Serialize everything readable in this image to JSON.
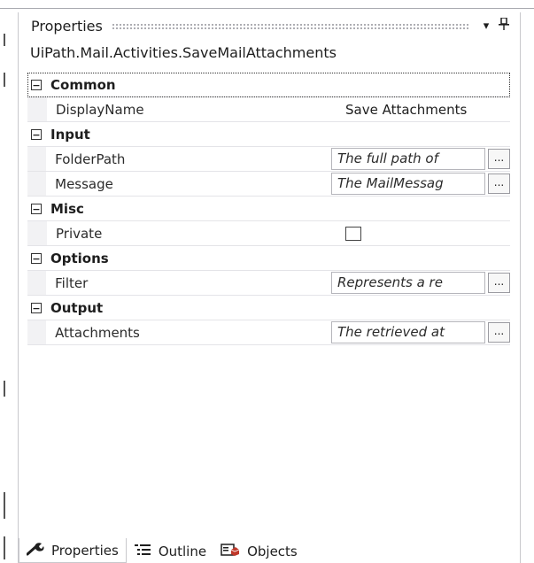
{
  "panel": {
    "title": "Properties",
    "dropdown_glyph": "▾",
    "pin_glyph": "⊥",
    "type_name": "UiPath.Mail.Activities.SaveMailAttachments"
  },
  "categories": [
    {
      "toggle": "−",
      "label": "Common",
      "props": [
        {
          "name": "DisplayName",
          "kind": "plain",
          "value": "Save Attachments"
        }
      ]
    },
    {
      "toggle": "−",
      "label": "Input",
      "props": [
        {
          "name": "FolderPath",
          "kind": "field",
          "value": "The full path of",
          "button": "..."
        },
        {
          "name": "Message",
          "kind": "field",
          "value": "The MailMessag",
          "button": "..."
        }
      ]
    },
    {
      "toggle": "−",
      "label": "Misc",
      "props": [
        {
          "name": "Private",
          "kind": "checkbox",
          "checked": false
        }
      ]
    },
    {
      "toggle": "−",
      "label": "Options",
      "props": [
        {
          "name": "Filter",
          "kind": "field",
          "value": "Represents a re",
          "button": "..."
        }
      ]
    },
    {
      "toggle": "−",
      "label": "Output",
      "props": [
        {
          "name": "Attachments",
          "kind": "field",
          "value": "The retrieved at",
          "button": "..."
        }
      ]
    }
  ],
  "tabs": [
    {
      "label": "Properties",
      "icon": "wrench-icon",
      "active": true
    },
    {
      "label": "Outline",
      "icon": "outline-icon",
      "active": false
    },
    {
      "label": "Objects",
      "icon": "objects-icon",
      "active": false
    }
  ]
}
